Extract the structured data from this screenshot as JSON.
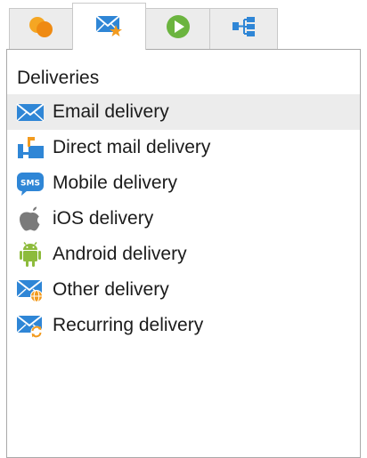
{
  "tabs": [
    {
      "icon": "orange-circles-icon",
      "active": false
    },
    {
      "icon": "envelope-star-icon",
      "active": true
    },
    {
      "icon": "play-icon",
      "active": false
    },
    {
      "icon": "hierarchy-icon",
      "active": false
    }
  ],
  "panel": {
    "heading": "Deliveries",
    "items": [
      {
        "label": "Email delivery",
        "icon": "email-icon",
        "selected": true
      },
      {
        "label": "Direct mail delivery",
        "icon": "mailbox-icon",
        "selected": false
      },
      {
        "label": "Mobile delivery",
        "icon": "sms-icon",
        "selected": false
      },
      {
        "label": "iOS delivery",
        "icon": "apple-icon",
        "selected": false
      },
      {
        "label": "Android delivery",
        "icon": "android-icon",
        "selected": false
      },
      {
        "label": "Other delivery",
        "icon": "envelope-globe-icon",
        "selected": false
      },
      {
        "label": "Recurring delivery",
        "icon": "envelope-recurring-icon",
        "selected": false
      }
    ]
  },
  "colors": {
    "accent_blue": "#2f86d6",
    "orange": "#f29b1f",
    "green": "#6bb43f",
    "selected_row": "#ececec"
  }
}
